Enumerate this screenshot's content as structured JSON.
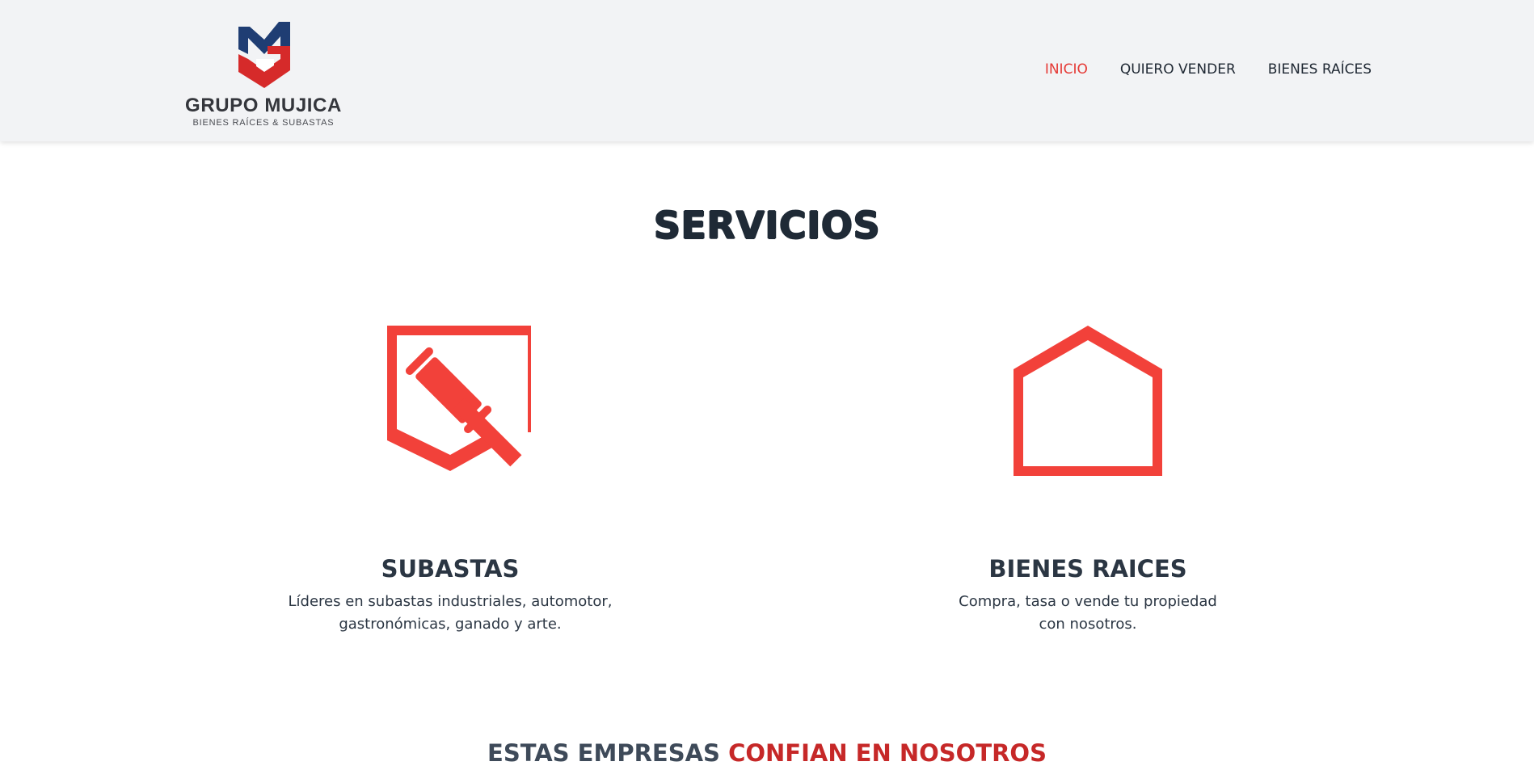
{
  "header": {
    "logo": {
      "name": "GRUPO MUJICA",
      "tagline": "BIENES RAÍCES & SUBASTAS"
    },
    "nav": [
      {
        "label": "INICIO",
        "active": true
      },
      {
        "label": "QUIERO VENDER",
        "active": false
      },
      {
        "label": "BIENES RAÍCES",
        "active": false
      }
    ]
  },
  "services": {
    "title": "SERVICIOS",
    "items": [
      {
        "icon": "gavel-shield-icon",
        "title": "SUBASTAS",
        "description": "Líderes en subastas industriales, automotor,\ngastronómicas, ganado y arte."
      },
      {
        "icon": "house-outline-icon",
        "title": "BIENES RAICES",
        "description": "Compra, tasa o vende tu propiedad\ncon nosotros."
      }
    ]
  },
  "trust": {
    "lead": "ESTAS EMPRESAS",
    "accent": "CONFIAN EN NOSOTROS"
  },
  "colors": {
    "accent_red": "#f2413a",
    "logo_blue": "#1f3d73",
    "logo_red": "#d62a2a",
    "header_bg": "#f2f3f5",
    "heading_dark": "#2b3643"
  }
}
